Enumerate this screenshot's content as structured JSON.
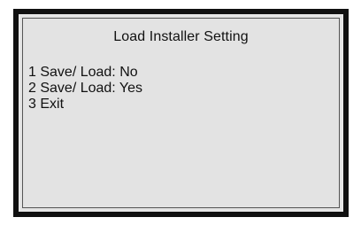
{
  "screen": {
    "title": "Load Installer Setting",
    "menu_items": [
      {
        "label": "1 Save/ Load: No"
      },
      {
        "label": "2 Save/ Load: Yes"
      },
      {
        "label": "3 Exit"
      }
    ]
  },
  "colors": {
    "frame": "#111111",
    "screen_background": "#e3e3e3",
    "text": "#111111"
  }
}
